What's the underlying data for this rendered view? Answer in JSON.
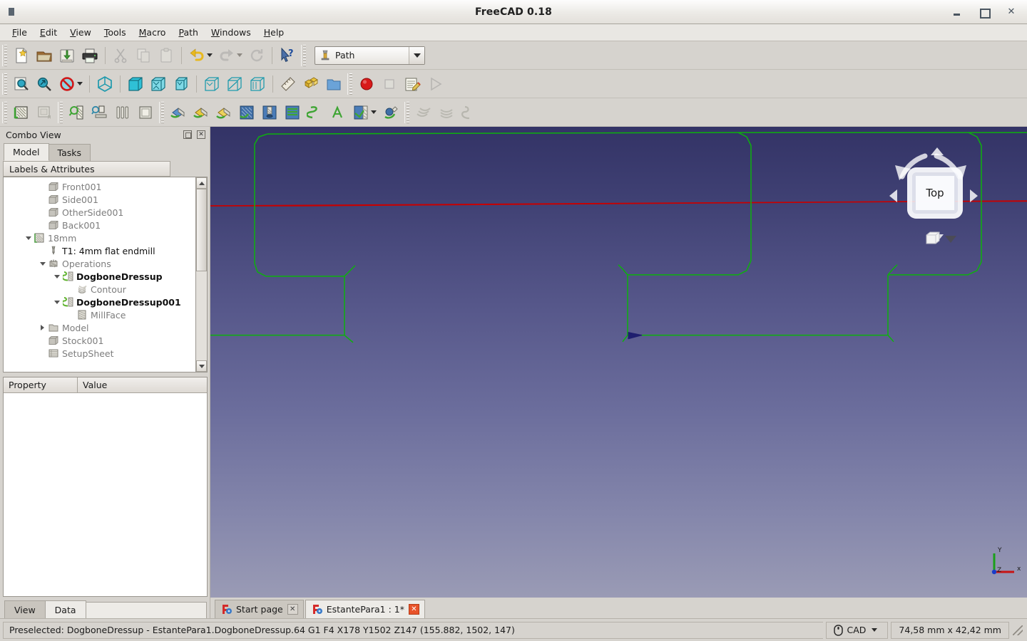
{
  "window": {
    "title": "FreeCAD 0.18",
    "buttons": {
      "minimize": "–",
      "maximize": "□",
      "close": "✕"
    }
  },
  "menubar": {
    "items": [
      {
        "label": "File",
        "mnemonic": "F"
      },
      {
        "label": "Edit",
        "mnemonic": "E"
      },
      {
        "label": "View",
        "mnemonic": "V"
      },
      {
        "label": "Tools",
        "mnemonic": "T"
      },
      {
        "label": "Macro",
        "mnemonic": "M"
      },
      {
        "label": "Path",
        "mnemonic": "P"
      },
      {
        "label": "Windows",
        "mnemonic": "W"
      },
      {
        "label": "Help",
        "mnemonic": "H"
      }
    ]
  },
  "toolbars": {
    "file": [
      {
        "name": "new-document-icon",
        "label": "New"
      },
      {
        "name": "open-document-icon",
        "label": "Open"
      },
      {
        "name": "save-document-icon",
        "label": "Save"
      },
      {
        "name": "print-icon",
        "label": "Print"
      },
      {
        "name": "cut-icon",
        "label": "Cut"
      },
      {
        "name": "copy-icon",
        "label": "Copy"
      },
      {
        "name": "paste-icon",
        "label": "Paste"
      },
      {
        "name": "undo-icon",
        "label": "Undo"
      },
      {
        "name": "redo-icon",
        "label": "Redo"
      },
      {
        "name": "refresh-icon",
        "label": "Refresh"
      },
      {
        "name": "whats-this-icon",
        "label": "What's This"
      }
    ],
    "workbench": {
      "label": "Path",
      "icon": "endmill-icon"
    },
    "view": [
      {
        "name": "fit-all-icon",
        "label": "Fit all"
      },
      {
        "name": "fit-selection-icon",
        "label": "Fit selection"
      },
      {
        "name": "draw-style-icon",
        "label": "Draw style"
      },
      {
        "name": "axonometric-view-icon",
        "label": "Axonometric"
      },
      {
        "name": "front-view-icon",
        "label": "Front"
      },
      {
        "name": "top-view-icon",
        "label": "Top"
      },
      {
        "name": "right-view-icon",
        "label": "Right"
      },
      {
        "name": "rear-view-icon",
        "label": "Rear"
      },
      {
        "name": "bottom-view-icon",
        "label": "Bottom"
      },
      {
        "name": "left-view-icon",
        "label": "Left"
      },
      {
        "name": "measure-icon",
        "label": "Measure"
      }
    ],
    "structure": [
      {
        "name": "create-part-icon",
        "label": "Create part"
      },
      {
        "name": "create-group-icon",
        "label": "Create group"
      }
    ],
    "macro": [
      {
        "name": "macro-record-icon",
        "label": "Macro recording"
      },
      {
        "name": "macro-stop-icon",
        "label": "Stop macro recording"
      },
      {
        "name": "macro-edit-icon",
        "label": "Macros"
      },
      {
        "name": "macro-execute-icon",
        "label": "Execute macro"
      }
    ],
    "path_job": [
      {
        "name": "path-job-icon",
        "label": "Job"
      },
      {
        "name": "path-post-process-icon",
        "label": "Post Process"
      }
    ],
    "path_tools": [
      {
        "name": "path-inspect-icon",
        "label": "Inspect G-code"
      },
      {
        "name": "path-simulator-icon",
        "label": "Simulator"
      },
      {
        "name": "path-toolbit-library-icon",
        "label": "ToolBit Library"
      },
      {
        "name": "path-stock-icon",
        "label": "Stock"
      }
    ],
    "path_ops": [
      {
        "name": "path-profile-face-icon",
        "label": "Profile Faces"
      },
      {
        "name": "path-profile-edges-icon",
        "label": "Profile Edges"
      },
      {
        "name": "path-contour-icon",
        "label": "Contour"
      },
      {
        "name": "path-pocket-shape-icon",
        "label": "Pocket Shape"
      },
      {
        "name": "path-drilling-icon",
        "label": "Drilling"
      },
      {
        "name": "path-mill-face-icon",
        "label": "Face"
      },
      {
        "name": "path-helix-icon",
        "label": "Helix"
      },
      {
        "name": "path-engrave-icon",
        "label": "Engrave"
      },
      {
        "name": "path-surface-icon",
        "label": "3D Surface"
      },
      {
        "name": "path-adaptive-icon",
        "label": "Adaptive"
      }
    ],
    "path_dressup": [
      {
        "name": "path-array-icon",
        "label": "Array"
      },
      {
        "name": "path-copy-icon",
        "label": "Copy"
      },
      {
        "name": "path-dogbone-dressup-icon",
        "label": "DressupDogbone"
      }
    ]
  },
  "combo_view": {
    "title": "Combo View",
    "float_button": "float",
    "close_button": "✕",
    "tabs": [
      {
        "label": "Model",
        "active": true
      },
      {
        "label": "Tasks",
        "active": false
      }
    ],
    "labels_header": "Labels & Attributes",
    "tree": [
      {
        "label": "Front001",
        "indent": 2,
        "icon": "solid-box-icon",
        "style": "grey",
        "expander": "none"
      },
      {
        "label": "Side001",
        "indent": 2,
        "icon": "solid-box-icon",
        "style": "grey",
        "expander": "none"
      },
      {
        "label": "OtherSide001",
        "indent": 2,
        "icon": "solid-box-icon",
        "style": "grey",
        "expander": "none"
      },
      {
        "label": "Back001",
        "indent": 2,
        "icon": "solid-box-icon",
        "style": "grey",
        "expander": "none"
      },
      {
        "label": "18mm",
        "indent": 1,
        "icon": "toolbit-icon",
        "style": "grey",
        "expander": "open"
      },
      {
        "label": "T1: 4mm flat endmill",
        "indent": 2,
        "icon": "endmill-tool-icon",
        "style": "dark",
        "expander": "none"
      },
      {
        "label": "Operations",
        "indent": 2,
        "icon": "operations-icon",
        "style": "grey",
        "expander": "open"
      },
      {
        "label": "DogboneDressup",
        "indent": 3,
        "icon": "dogbone-icon",
        "style": "bold",
        "expander": "open"
      },
      {
        "label": "Contour",
        "indent": 4,
        "icon": "contour-icon",
        "style": "grey",
        "expander": "none"
      },
      {
        "label": "DogboneDressup001",
        "indent": 3,
        "icon": "dogbone-icon",
        "style": "bold",
        "expander": "open"
      },
      {
        "label": "MillFace",
        "indent": 4,
        "icon": "millface-icon",
        "style": "grey",
        "expander": "none"
      },
      {
        "label": "Model",
        "indent": 2,
        "icon": "folder-icon",
        "style": "grey",
        "expander": "closed"
      },
      {
        "label": "Stock001",
        "indent": 2,
        "icon": "solid-box-icon",
        "style": "grey",
        "expander": "none"
      },
      {
        "label": "SetupSheet",
        "indent": 2,
        "icon": "setupsheet-icon",
        "style": "grey",
        "expander": "none"
      }
    ],
    "property_header": {
      "property": "Property",
      "value": "Value"
    },
    "bottom_tabs": [
      {
        "label": "View",
        "active": false
      },
      {
        "label": "Data",
        "active": true
      }
    ]
  },
  "view3d": {
    "navigation_cube": {
      "face_label": "Top"
    },
    "axis_cross": {
      "x": "x",
      "y": "Y",
      "z": "Z"
    },
    "colors": {
      "toolpath_green": "#0db10d",
      "rapid_red": "#c80000",
      "marker_navy": "#1f1f6e",
      "background_top": "#333366",
      "background_bottom": "#9a9bb5"
    }
  },
  "document_tabs": [
    {
      "label": "Start page",
      "active": false,
      "icon": "freecad-logo-icon",
      "close": "✕"
    },
    {
      "label": "EstantePara1 : 1*",
      "active": true,
      "icon": "freecad-logo-icon",
      "close": "✕"
    }
  ],
  "statusbar": {
    "message": "Preselected: DogboneDressup - EstantePara1.DogboneDressup.64 G1 F4 X178 Y1502 Z147 (155.882, 1502, 147)",
    "navigation_mode": "CAD",
    "navigation_icon": "mouse-icon",
    "dimensions": "74,58 mm x 42,42 mm"
  }
}
